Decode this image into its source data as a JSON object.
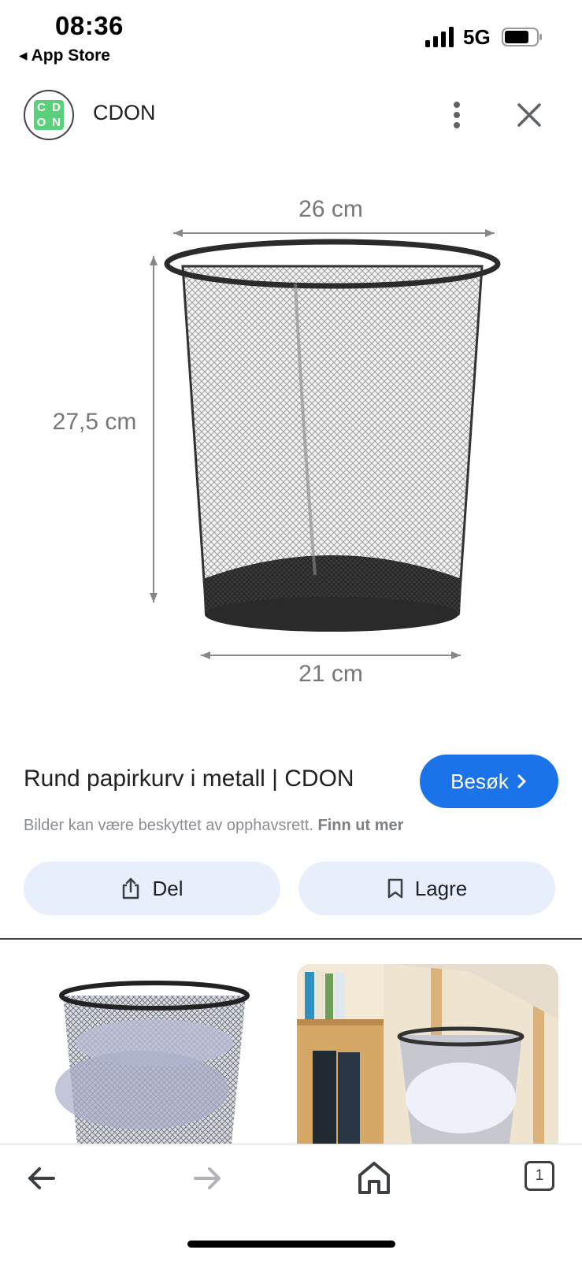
{
  "status_bar": {
    "time": "08:36",
    "back_app": "◂ App Store",
    "network": "5G"
  },
  "header": {
    "site_name": "CDON",
    "logo_letters": [
      "C",
      "D",
      "O",
      "N"
    ],
    "menu_icon": "more-vert-icon",
    "close_icon": "close-icon"
  },
  "hero": {
    "width_label": "26 cm",
    "height_label": "27,5 cm",
    "base_label": "21 cm"
  },
  "result": {
    "title": "Rund papirkurv i metall | CDON",
    "visit_label": "Besøk",
    "copyright_text": "Bilder kan være beskyttet av opphavsrett.",
    "learn_more": "Finn ut mer",
    "share_label": "Del",
    "save_label": "Lagre"
  },
  "bottom_nav": {
    "tab_count": "1"
  },
  "colors": {
    "accent": "#1a73e8",
    "pill_bg": "#e8effc",
    "logo_green": "#5bd07a"
  }
}
